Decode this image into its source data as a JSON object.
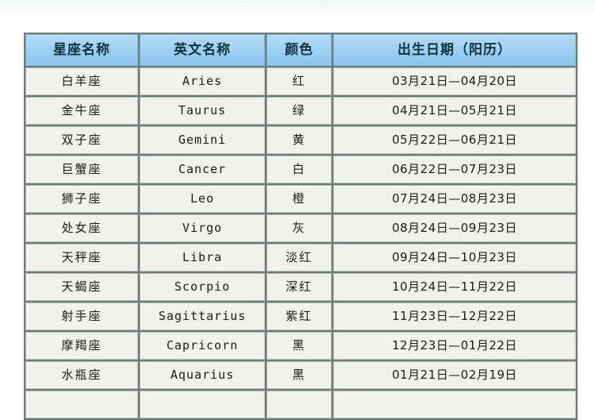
{
  "page": {
    "background_color": "#ffffff",
    "top_strip_ghost_text_1": "……",
    "top_strip_ghost_text_2": "…",
    "top_strip_ghost_text_3": "……"
  },
  "colors": {
    "header_background": "#9ccef2",
    "header_text": "#12313f",
    "cell_background": "#f1f2ee",
    "cell_text": "#1b1b1b",
    "grid_line": "#6f7a78"
  },
  "table": {
    "headers": [
      "星座名称",
      "英文名称",
      "颜色",
      "出生日期（阳历）"
    ],
    "rows": [
      {
        "name": "白羊座",
        "english": "Aries",
        "color": "红",
        "date": "03月21日—04月20日"
      },
      {
        "name": "金牛座",
        "english": "Taurus",
        "color": "绿",
        "date": "04月21日—05月21日"
      },
      {
        "name": "双子座",
        "english": "Gemini",
        "color": "黄",
        "date": "05月22日—06月21日"
      },
      {
        "name": "巨蟹座",
        "english": "Cancer",
        "color": "白",
        "date": "06月22日—07月23日"
      },
      {
        "name": "狮子座",
        "english": "Leo",
        "color": "橙",
        "date": "07月24日—08月23日"
      },
      {
        "name": "处女座",
        "english": "Virgo",
        "color": "灰",
        "date": "08月24日—09月23日"
      },
      {
        "name": "天秤座",
        "english": "Libra",
        "color": "淡红",
        "date": "09月24日—10月23日"
      },
      {
        "name": "天蝎座",
        "english": "Scorpio",
        "color": "深红",
        "date": "10月24日—11月22日"
      },
      {
        "name": "射手座",
        "english": "Sagittarius",
        "color": "紫红",
        "date": "11月23日—12月22日"
      },
      {
        "name": "摩羯座",
        "english": "Capricorn",
        "color": "黑",
        "date": "12月23日—01月22日"
      },
      {
        "name": "水瓶座",
        "english": "Aquarius",
        "color": "黑",
        "date": "01月21日—02月19日"
      }
    ]
  }
}
